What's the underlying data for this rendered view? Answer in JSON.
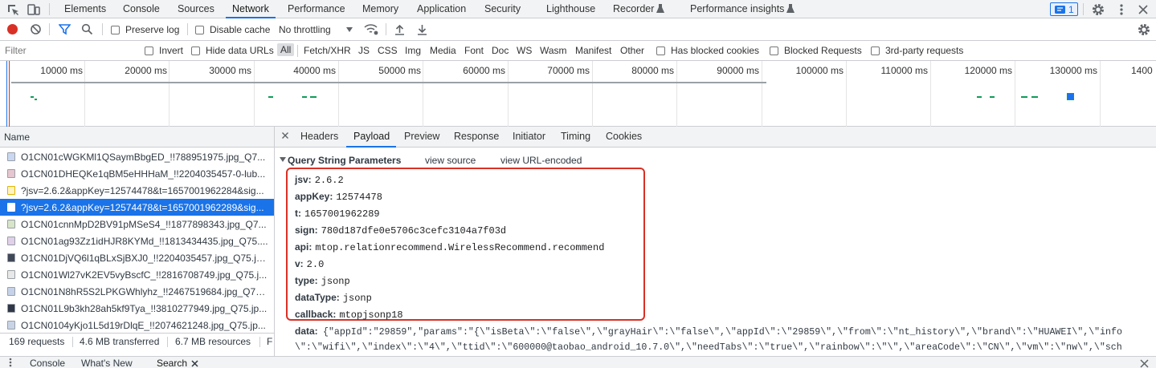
{
  "topbar": {
    "tabs": [
      "Elements",
      "Console",
      "Sources",
      "Network",
      "Performance",
      "Memory",
      "Application",
      "Security",
      "Lighthouse",
      "Recorder",
      "Performance insights"
    ],
    "active_tab": "Network",
    "issues_count": "1"
  },
  "toolbar": {
    "preserve_log": "Preserve log",
    "disable_cache": "Disable cache",
    "throttling": "No throttling"
  },
  "filterbar": {
    "placeholder": "Filter",
    "invert": "Invert",
    "hide_data_urls": "Hide data URLs",
    "types": [
      "All",
      "Fetch/XHR",
      "JS",
      "CSS",
      "Img",
      "Media",
      "Font",
      "Doc",
      "WS",
      "Wasm",
      "Manifest",
      "Other"
    ],
    "has_blocked_cookies": "Has blocked cookies",
    "blocked_requests": "Blocked Requests",
    "third_party": "3rd-party requests"
  },
  "timeline": {
    "ticks": [
      "10000 ms",
      "20000 ms",
      "30000 ms",
      "40000 ms",
      "50000 ms",
      "60000 ms",
      "70000 ms",
      "80000 ms",
      "90000 ms",
      "100000 ms",
      "110000 ms",
      "120000 ms",
      "130000 ms",
      "1400"
    ]
  },
  "requests": {
    "header": "Name",
    "rows": [
      "O1CN01cWGKMl1QSaymBbgED_!!788951975.jpg_Q7...",
      "O1CN01DHEQKe1qBM5eHHHaM_!!2204035457-0-lub...",
      "?jsv=2.6.2&appKey=12574478&t=1657001962284&sig...",
      "?jsv=2.6.2&appKey=12574478&t=1657001962289&sig...",
      "O1CN01cnnMpD2BV91pMSeS4_!!1877898343.jpg_Q7...",
      "O1CN01ag93Zz1idHJR8KYMd_!!1813434435.jpg_Q75....",
      "O1CN01DjVQ6l1qBLxSjBXJ0_!!2204035457.jpg_Q75.jp...",
      "O1CN01Wl27vK2EV5vyBscfC_!!2816708749.jpg_Q75.j...",
      "O1CN01N8hR5S2LPKGWhlyhz_!!2467519684.jpg_Q75....",
      "O1CN01L9b3kh28ah5kf9Tya_!!3810277949.jpg_Q75.jp...",
      "O1CN0104yKjo1L5d19rDlqE_!!2074621248.jpg_Q75.jp..."
    ],
    "selected_index": 3
  },
  "status": {
    "requests": "169 requests",
    "transferred": "4.6 MB transferred",
    "resources": "6.7 MB resources",
    "extra": "F"
  },
  "detail": {
    "tabs": [
      "Headers",
      "Payload",
      "Preview",
      "Response",
      "Initiator",
      "Timing",
      "Cookies"
    ],
    "active_tab": "Payload",
    "section_title": "Query String Parameters",
    "view_source": "view source",
    "view_url_encoded": "view URL-encoded",
    "params": [
      {
        "k": "jsv:",
        "v": "2.6.2"
      },
      {
        "k": "appKey:",
        "v": "12574478"
      },
      {
        "k": "t:",
        "v": "1657001962289"
      },
      {
        "k": "sign:",
        "v": "780d187dfe0e5706c3cefc3104a7f03d"
      },
      {
        "k": "api:",
        "v": "mtop.relationrecommend.WirelessRecommend.recommend"
      },
      {
        "k": "v:",
        "v": "2.0"
      },
      {
        "k": "type:",
        "v": "jsonp"
      },
      {
        "k": "dataType:",
        "v": "jsonp"
      },
      {
        "k": "callback:",
        "v": "mtopjsonp18"
      }
    ],
    "data_key": "data:",
    "data_line1": "{\"appId\":\"29859\",\"params\":\"{\\\"isBeta\\\":\\\"false\\\",\\\"grayHair\\\":\\\"false\\\",\\\"appId\\\":\\\"29859\\\",\\\"from\\\":\\\"nt_history\\\",\\\"brand\\\":\\\"HUAWEI\\\",\\\"info",
    "data_line2": "\\\":\\\"wifi\\\",\\\"index\\\":\\\"4\\\",\\\"ttid\\\":\\\"600000@taobao_android_10.7.0\\\",\\\"needTabs\\\":\\\"true\\\",\\\"rainbow\\\":\\\"\\\",\\\"areaCode\\\":\\\"CN\\\",\\\"vm\\\":\\\"nw\\\",\\\"sch"
  },
  "drawer": {
    "tabs": [
      "Console",
      "What's New",
      "Search"
    ]
  },
  "colors": {
    "accent": "#1a73e8",
    "highlight_box": "#d93025",
    "record": "#d93025"
  }
}
